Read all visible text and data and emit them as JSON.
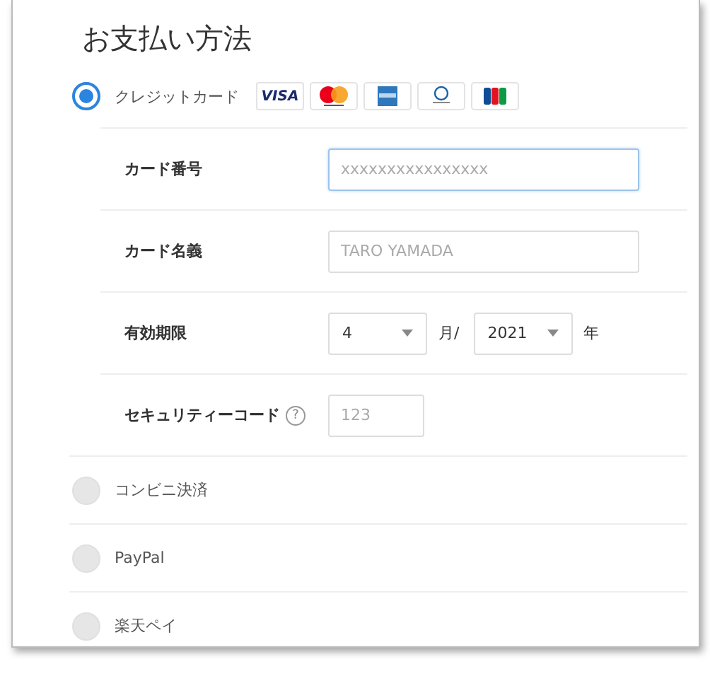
{
  "title": "お支払い方法",
  "payment_methods": [
    {
      "kind": "card",
      "label": "クレジットカード",
      "selected": true
    },
    {
      "kind": "plain",
      "label": "コンビニ決済",
      "selected": false
    },
    {
      "kind": "plain",
      "label": "PayPal",
      "selected": false
    },
    {
      "kind": "plain",
      "label": "楽天ペイ",
      "selected": false
    }
  ],
  "card_brands": [
    {
      "kind": "visa",
      "label": "VISA"
    },
    {
      "kind": "mastercard"
    },
    {
      "kind": "amex"
    },
    {
      "kind": "diners"
    },
    {
      "kind": "jcb"
    }
  ],
  "card_form": [
    {
      "kind": "text",
      "label": "カード番号",
      "placeholder": "xxxxxxxxxxxxxxxx",
      "focused": true
    },
    {
      "kind": "text",
      "label": "カード名義",
      "placeholder": "TARO YAMADA",
      "focused": false
    },
    {
      "kind": "expiry",
      "label": "有効期限",
      "month": "4",
      "month_unit": "月/",
      "year": "2021",
      "year_unit": "年"
    },
    {
      "kind": "security",
      "label": "セキュリティーコード",
      "help": "?",
      "placeholder": "123"
    }
  ]
}
